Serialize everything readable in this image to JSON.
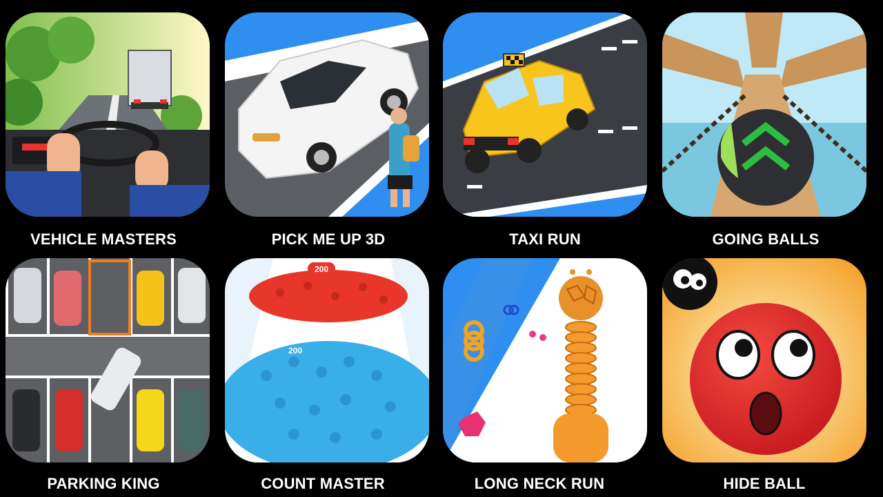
{
  "games": [
    {
      "title": "VEHICLE MASTERS",
      "art": "truck-driving-icon"
    },
    {
      "title": "PICK ME UP 3D",
      "art": "white-car-passenger-icon"
    },
    {
      "title": "TAXI RUN",
      "art": "yellow-taxi-icon"
    },
    {
      "title": "GOING BALLS",
      "art": "rolling-ball-track-icon"
    },
    {
      "title": "PARKING KING",
      "art": "parking-lot-icon"
    },
    {
      "title": "COUNT MASTER",
      "art": "crowd-runner-icon",
      "counts": [
        "200",
        "200"
      ]
    },
    {
      "title": "LONG NECK RUN",
      "art": "long-neck-giraffe-icon"
    },
    {
      "title": "HIDE BALL",
      "art": "red-ball-face-icon"
    }
  ],
  "colors": {
    "background": "#000000",
    "label": "#ffffff",
    "taxi_yellow": "#f7c51c",
    "crowd_blue": "#3aaee8",
    "crowd_red": "#e8362b",
    "ball_red": "#e3262a"
  }
}
